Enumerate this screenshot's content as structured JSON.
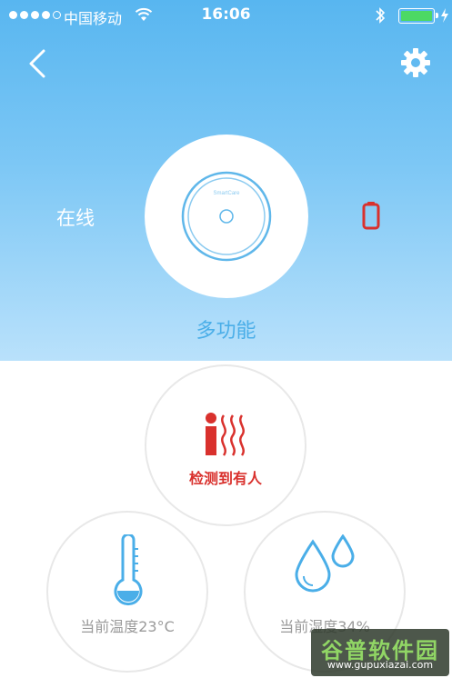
{
  "status_bar": {
    "carrier": "中国移动",
    "time": "16:06",
    "signal_bars_filled": 4,
    "signal_bars_total": 5,
    "battery_level": 1.0,
    "battery_color": "#4cd964"
  },
  "nav": {
    "back_icon": "chevron-left-icon",
    "settings_icon": "gear-icon"
  },
  "device": {
    "status": "在线",
    "logo_text": "SmartCare",
    "name": "多功能",
    "battery_icon": "battery-low-icon",
    "battery_color": "#d9312d"
  },
  "sensors": {
    "presence": {
      "label": "检测到有人",
      "icon": "person-heat-icon",
      "color": "#d9312d"
    },
    "temperature": {
      "label": "当前温度23°C",
      "icon": "thermometer-icon",
      "color": "#4aaee8"
    },
    "humidity": {
      "label": "当前湿度34%",
      "icon": "water-drops-icon",
      "color": "#4aaee8"
    }
  },
  "watermark": {
    "title": "谷普软件园",
    "url": "www.gupuxiazai.com"
  },
  "colors": {
    "accent": "#4aaee8",
    "hero_top": "#58b6f0",
    "hero_bottom": "#b9e1fb",
    "alert": "#d9312d"
  }
}
